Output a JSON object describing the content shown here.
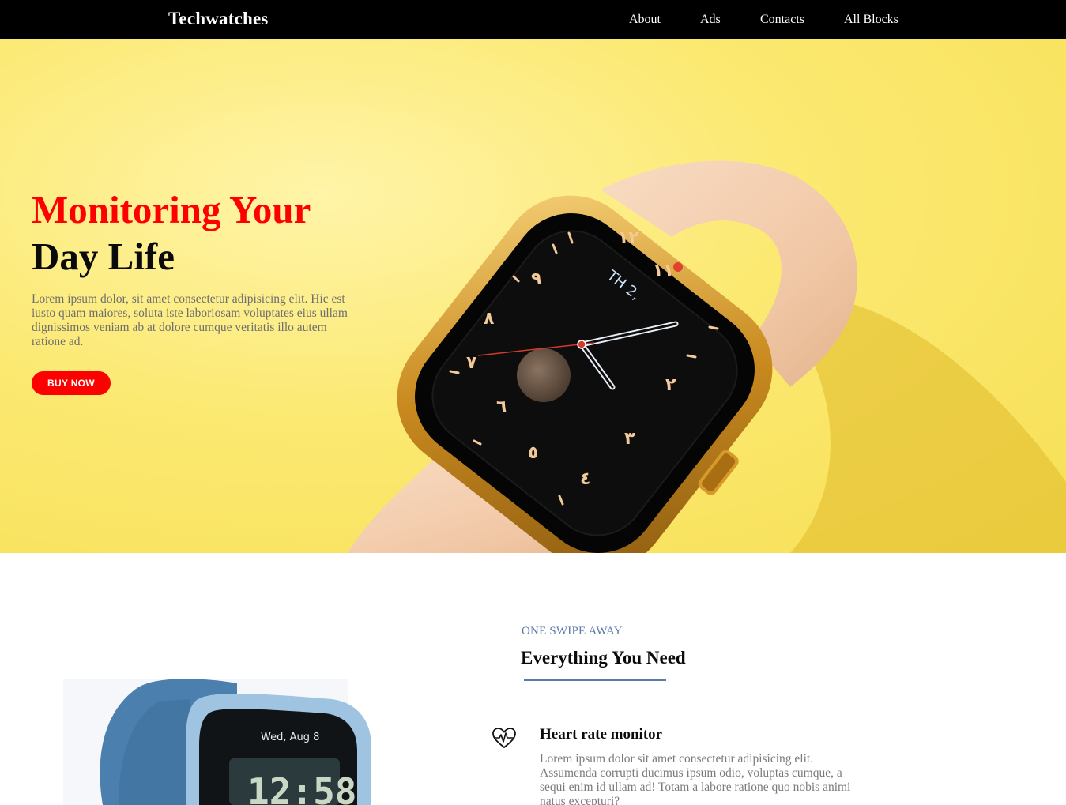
{
  "nav": {
    "brand": "Techwatches",
    "links": [
      "About",
      "Ads",
      "Contacts",
      "All Blocks"
    ]
  },
  "hero": {
    "title_line1": "Monitoring Your",
    "title_line2": "Day Life",
    "description": "Lorem ipsum dolor, sit amet consectetur adipisicing elit. Hic est iusto quam maiores, soluta iste laboriosam voluptates eius ullam dignissimos veniam ab at dolore cumque veritatis illo autem ratione ad.",
    "button_label": "BUY NOW",
    "watch_face_text": "TH 2,",
    "colors": {
      "accent": "#ff0000",
      "background": "#f9e46a"
    }
  },
  "features": {
    "eyebrow": "ONE SWIPE AWAY",
    "title": "Everything You Need",
    "product_screen_date": "Wed, Aug 8",
    "product_screen_time": "12:58",
    "items": [
      {
        "icon": "heart-rate-icon",
        "title": "Heart rate monitor",
        "text": "Lorem ipsum dolor sit amet consectetur adipisicing elit. Assumenda corrupti ducimus ipsum odio, voluptas cumque, a sequi enim id ullam ad! Totam a labore ratione quo nobis animi natus excepturi?"
      }
    ],
    "colors": {
      "accent": "#5a7aa8"
    }
  }
}
